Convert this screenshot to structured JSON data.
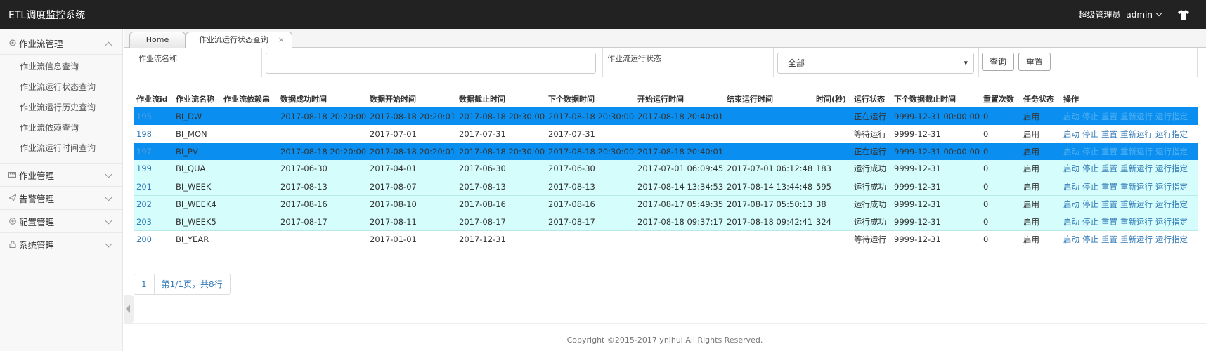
{
  "app": {
    "title": "ETL调度监控系统"
  },
  "user": {
    "role": "超级管理员",
    "name": "admin"
  },
  "sidebar": {
    "groups": [
      {
        "label": "作业流管理",
        "items": [
          "作业流信息查询",
          "作业流运行状态查询",
          "作业流运行历史查询",
          "作业流依赖查询",
          "作业流运行时间查询"
        ]
      },
      {
        "label": "作业管理"
      },
      {
        "label": "告警管理"
      },
      {
        "label": "配置管理"
      },
      {
        "label": "系统管理"
      }
    ]
  },
  "tabs": {
    "home": "Home",
    "current": "作业流运行状态查询",
    "close": "×"
  },
  "filter": {
    "name_label": "作业流名称",
    "name_value": "",
    "status_label": "作业流运行状态",
    "status_value": "全部",
    "query_button": "查询",
    "reset_button": "重置"
  },
  "table": {
    "headers": [
      "作业流id",
      "作业流名称",
      "作业流依赖串",
      "数据成功时间",
      "数据开始时间",
      "数据截止时间",
      "下个数据时间",
      "开始运行时间",
      "结束运行时间",
      "时间(秒)",
      "运行状态",
      "下个数据截止时间",
      "重置次数",
      "任务状态",
      "操作"
    ],
    "ops": [
      "启动",
      "停止",
      "重置",
      "重新运行",
      "运行指定"
    ],
    "rows": [
      {
        "state": "running",
        "cells": [
          "195",
          "BI_DW",
          "",
          "2017-08-18 20:20:00",
          "2017-08-18 20:20:01",
          "2017-08-18 20:30:00",
          "2017-08-18 20:30:00",
          "2017-08-18 20:40:01",
          "",
          "",
          "正在运行",
          "9999-12-31 00:00:00",
          "0",
          "启用"
        ]
      },
      {
        "state": "waiting",
        "cells": [
          "198",
          "BI_MON",
          "",
          "",
          "2017-07-01",
          "2017-07-31",
          "2017-07-31",
          "",
          "",
          "",
          "等待运行",
          "9999-12-31",
          "0",
          "启用"
        ]
      },
      {
        "state": "running",
        "cells": [
          "197",
          "BI_PV",
          "",
          "2017-08-18 20:20:00",
          "2017-08-18 20:20:01",
          "2017-08-18 20:30:00",
          "2017-08-18 20:30:00",
          "2017-08-18 20:40:01",
          "",
          "",
          "正在运行",
          "9999-12-31 00:00:00",
          "0",
          "启用"
        ]
      },
      {
        "state": "success",
        "cells": [
          "199",
          "BI_QUA",
          "",
          "2017-06-30",
          "2017-04-01",
          "2017-06-30",
          "2017-06-30",
          "2017-07-01 06:09:45",
          "2017-07-01 06:12:48",
          "183",
          "运行成功",
          "9999-12-31",
          "0",
          "启用"
        ]
      },
      {
        "state": "success",
        "cells": [
          "201",
          "BI_WEEK",
          "",
          "2017-08-13",
          "2017-08-07",
          "2017-08-13",
          "2017-08-13",
          "2017-08-14 13:34:53",
          "2017-08-14 13:44:48",
          "595",
          "运行成功",
          "9999-12-31",
          "0",
          "启用"
        ]
      },
      {
        "state": "success",
        "cells": [
          "202",
          "BI_WEEK4",
          "",
          "2017-08-16",
          "2017-08-10",
          "2017-08-16",
          "2017-08-16",
          "2017-08-17 05:49:35",
          "2017-08-17 05:50:13",
          "38",
          "运行成功",
          "9999-12-31",
          "0",
          "启用"
        ]
      },
      {
        "state": "success",
        "cells": [
          "203",
          "BI_WEEK5",
          "",
          "2017-08-17",
          "2017-08-11",
          "2017-08-17",
          "2017-08-17",
          "2017-08-18 09:37:17",
          "2017-08-18 09:42:41",
          "324",
          "运行成功",
          "9999-12-31",
          "0",
          "启用"
        ]
      },
      {
        "state": "waiting",
        "cells": [
          "200",
          "BI_YEAR",
          "",
          "",
          "2017-01-01",
          "2017-12-31",
          "",
          "",
          "",
          "",
          "等待运行",
          "9999-12-31",
          "0",
          "启用"
        ]
      }
    ]
  },
  "pager": {
    "page": "1",
    "summary": "第1/1页，共8行"
  },
  "footer": {
    "copyright": "Copyright ©2015-2017 ynihui All Rights Reserved."
  },
  "colors": {
    "topbar": "#222222",
    "running": "#0a8ff0",
    "success": "#d4fdfc",
    "link": "#337ab7"
  }
}
